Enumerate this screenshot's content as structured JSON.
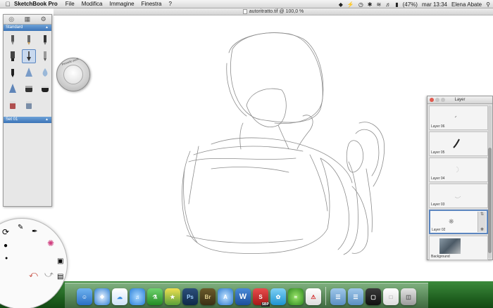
{
  "menubar": {
    "apple_icon": "apple-icon",
    "app_name": "SketchBook Pro",
    "menus": [
      "File",
      "Modifica",
      "Immagine",
      "Finestra",
      "?"
    ],
    "battery": "(47%)",
    "clock": "mar 13:34",
    "user": "Elena Abate"
  },
  "document": {
    "title": "autoritratto.tif @ 100,0 %"
  },
  "toolbox": {
    "brush_set_top": "Standard",
    "brush_set_bottom": "Set 01"
  },
  "puck": {
    "label": "Pennello puck"
  },
  "layer_panel": {
    "title": "Layer",
    "layers": [
      {
        "name": "Layer 06"
      },
      {
        "name": "Layer 05"
      },
      {
        "name": "Layer 04"
      },
      {
        "name": "Layer 03"
      },
      {
        "name": "Layer 02"
      },
      {
        "name": "Background"
      }
    ]
  },
  "dock": {
    "items": [
      "Finder",
      "Safari",
      "iCloud",
      "iTunes",
      "Growl",
      "Crossover",
      "Photoshop",
      "Bridge",
      "App Store",
      "Word",
      "SketchBook Pro",
      "Twitter",
      "Spotify",
      "Acrobat",
      "Applications",
      "Documents",
      "Downloads",
      "Stack",
      "Trash"
    ],
    "sbp_badge": "SBP"
  },
  "colors": {
    "accent": "#3b73b6",
    "selection": "#5b86c0",
    "dock_green": "#2d7a2d"
  }
}
